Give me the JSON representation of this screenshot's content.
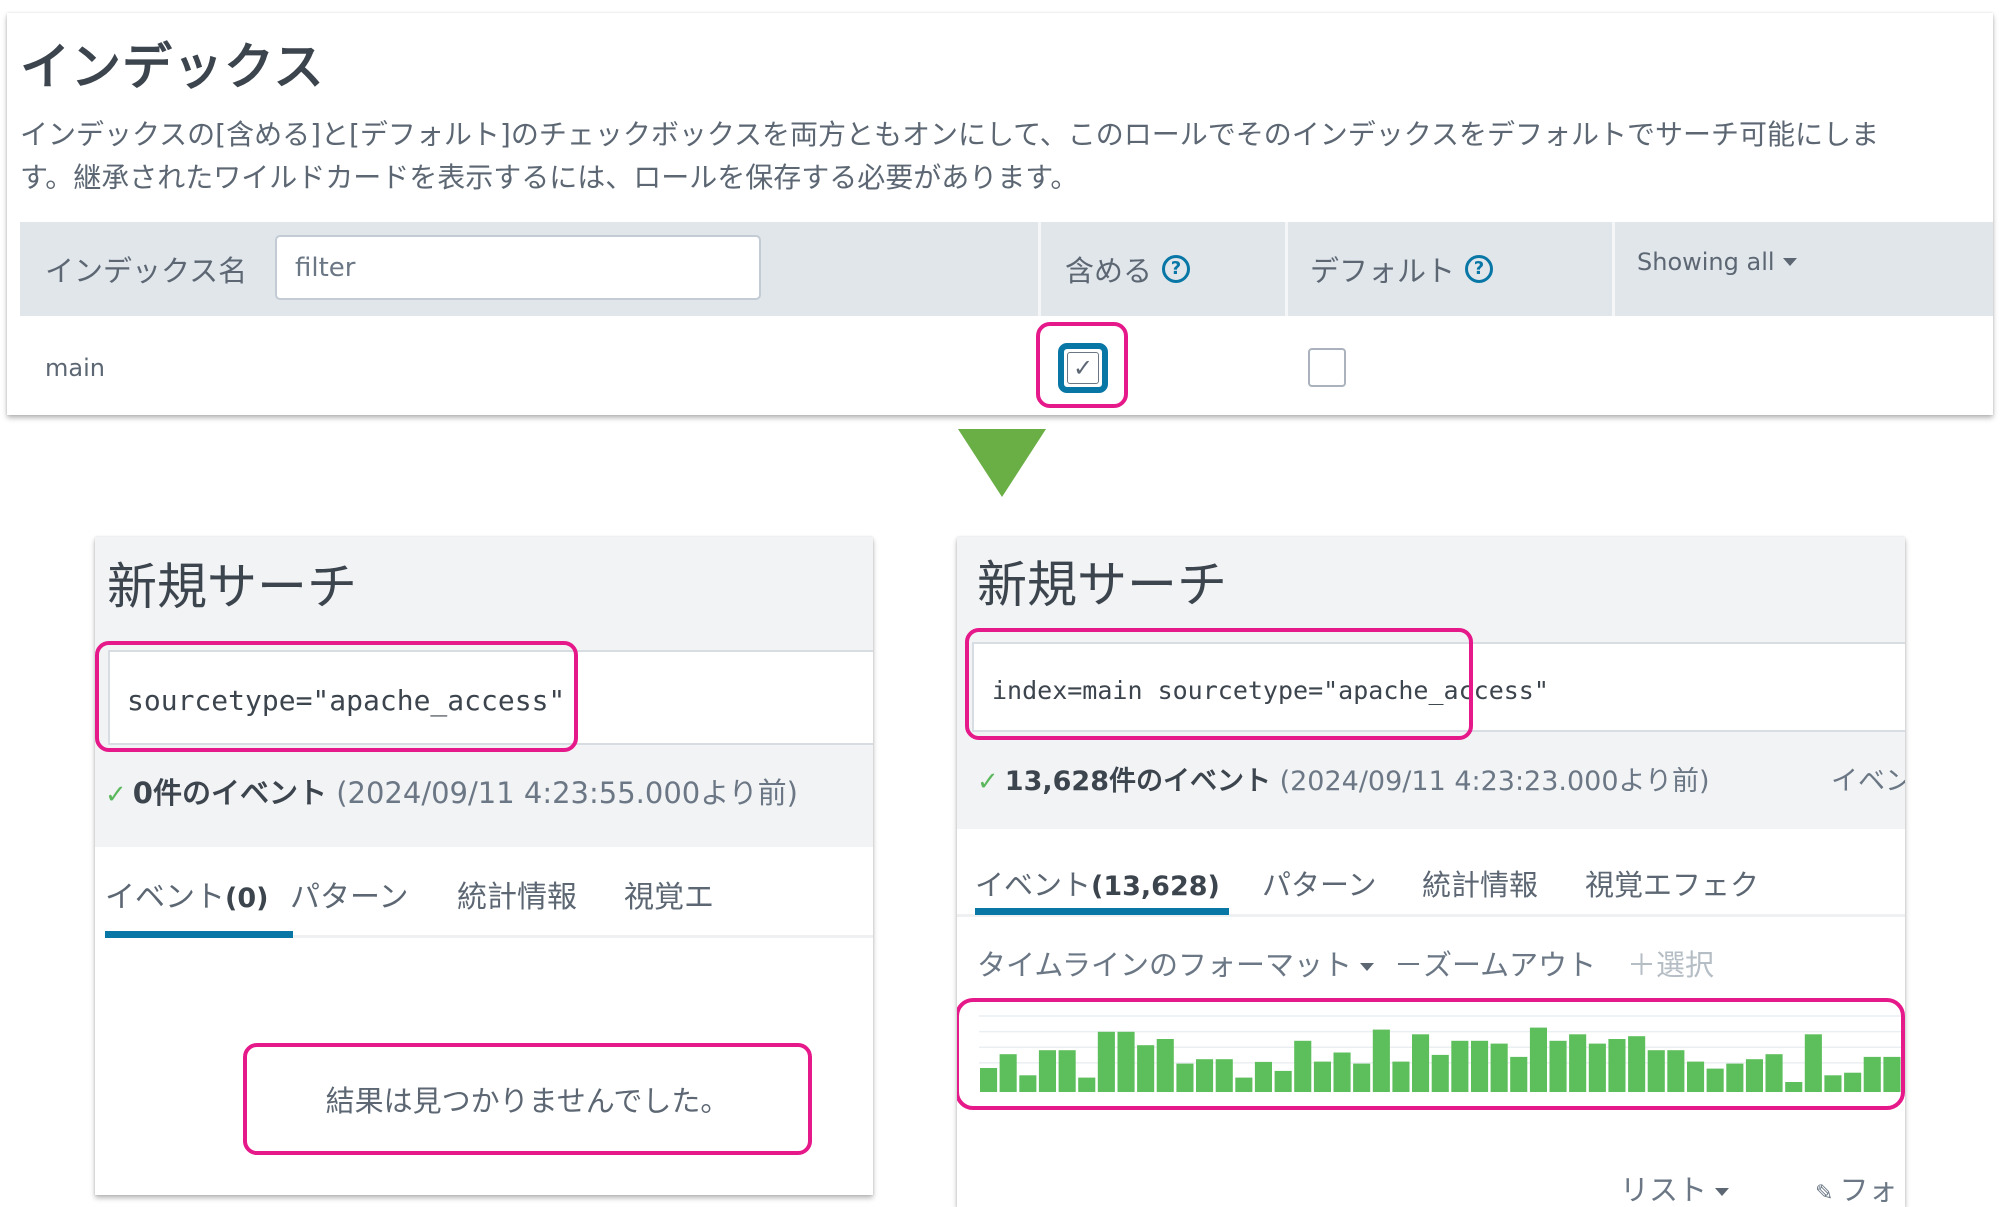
{
  "index_panel": {
    "title": "インデックス",
    "description_line1": "インデックスの[含める]と[デフォルト]のチェックボックスを両方ともオンにして、このロールでそのインデックスをデフォルトでサーチ可能にしま",
    "description_line2": "す。継承されたワイルドカードを表示するには、ロールを保存する必要があります。",
    "table": {
      "columns": {
        "name": "インデックス名",
        "include": "含める",
        "default": "デフォルト",
        "showing": "Showing all"
      },
      "filter_placeholder": "filter",
      "filter_value": "",
      "rows": [
        {
          "name": "main",
          "include": true,
          "default": false
        }
      ]
    },
    "include_checkbox_glyph": "✓",
    "help_glyph": "?"
  },
  "arrow": {
    "color": "#6aaf46",
    "direction": "down"
  },
  "highlight_color": "#e6198a",
  "left_search": {
    "title": "新規サーチ",
    "query": "sourcetype=\"apache_access\"",
    "status_check": "✓",
    "status_count": "0件のイベント",
    "status_time": "(2024/09/11 4:23:55.000より前)",
    "tabs": [
      {
        "label": "イベント",
        "count": "(0)",
        "active": true
      },
      {
        "label": "パターン",
        "count": "",
        "active": false
      },
      {
        "label": "統計情報",
        "count": "",
        "active": false
      },
      {
        "label": "視覚エ",
        "count": "",
        "active": false
      }
    ],
    "no_results": "結果は見つかりませんでした。"
  },
  "right_search": {
    "title": "新規サーチ",
    "query": "index=main sourcetype=\"apache_access\"",
    "status_check": "✓",
    "status_count": "13,628件のイベント",
    "status_time": "(2024/09/11 4:23:23.000より前)",
    "status_trailing": "イベン",
    "tabs": [
      {
        "label": "イベント",
        "count": "(13,628)",
        "active": true
      },
      {
        "label": "パターン",
        "count": "",
        "active": false
      },
      {
        "label": "統計情報",
        "count": "",
        "active": false
      },
      {
        "label": "視覚エフェク",
        "count": "",
        "active": false
      }
    ],
    "timeline_controls": {
      "format": "タイムラインのフォーマット",
      "zoom_out": "－ズームアウト",
      "select": "＋選択"
    },
    "footer": {
      "list": "リスト",
      "format_icon": "✎",
      "format": "フォ"
    }
  },
  "chart_data": {
    "type": "bar",
    "title": "",
    "xlabel": "",
    "ylabel": "",
    "grid": true,
    "color": "#5cbf5c",
    "note": "Relative event counts per time bucket (no axis labels shown; values in gridline units)",
    "ylim": [
      0,
      4.2
    ],
    "values": [
      1.54,
      2.42,
      1.07,
      2.68,
      2.68,
      0.92,
      3.86,
      3.86,
      3.0,
      3.4,
      1.82,
      2.1,
      2.1,
      0.92,
      1.93,
      1.35,
      3.28,
      1.95,
      2.53,
      1.82,
      4.0,
      1.95,
      3.7,
      2.38,
      3.28,
      3.28,
      3.1,
      2.25,
      4.13,
      3.28,
      3.7,
      3.1,
      3.4,
      3.58,
      2.68,
      2.68,
      1.95,
      1.5,
      1.82,
      2.1,
      2.42,
      0.64,
      3.7,
      1.07,
      1.24,
      2.25,
      2.25
    ]
  }
}
